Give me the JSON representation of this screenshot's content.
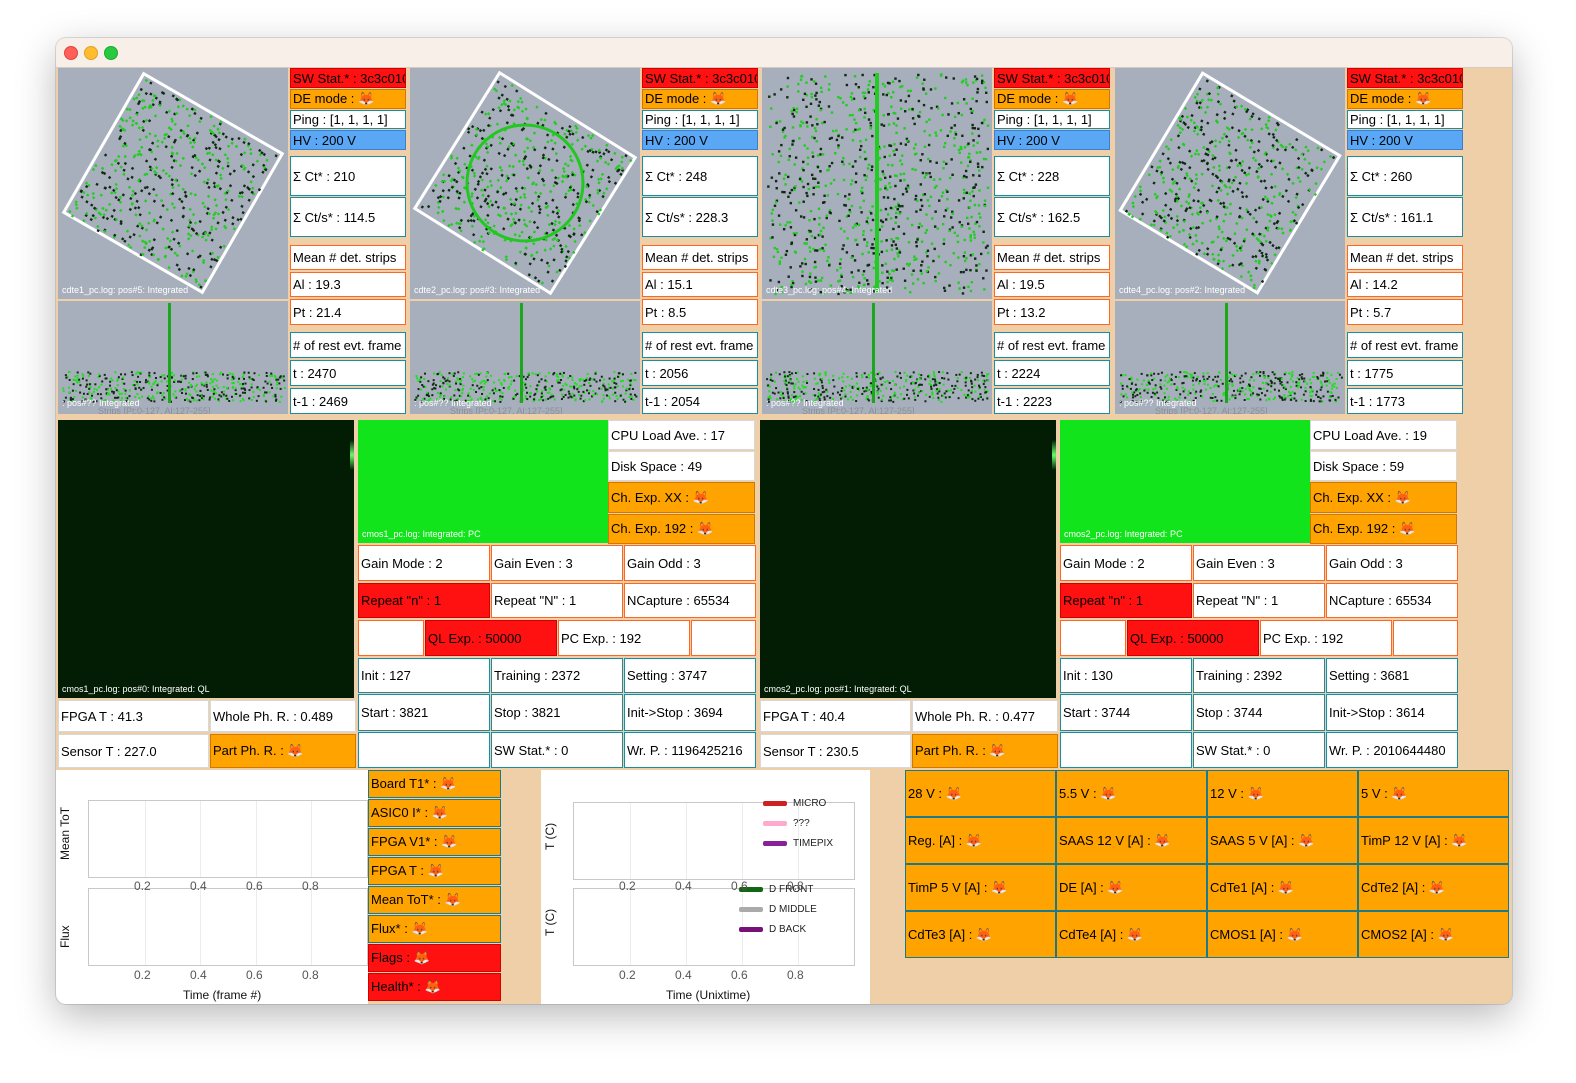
{
  "icons": {
    "status_icon": "fox-emoji"
  },
  "colors": {
    "red": "#ff1111",
    "orange": "#ffa300",
    "blue": "#5aa8f5",
    "green": "#11e41b"
  },
  "cdte": [
    {
      "sw_stat": "SW Stat.* : 3c3c010",
      "de_mode": "DE mode : 🦊",
      "ping": "Ping : [1, 1, 1, 1]",
      "hv": "HV : 200 V",
      "sum_ct": "Σ Ct* : 210",
      "sum_cts": "Σ Ct/s* : 114.5",
      "mean_label": "Mean # det. strips",
      "al": "Al : 19.3",
      "pt": "Pt : 21.4",
      "rest_label": "# of rest evt. frame",
      "t": "t : 2470",
      "t1": "t-1 : 2469",
      "img_label": "cdte1_pc.log: pos#5: Integrated",
      "strip_label": ": pos#?? Integrated",
      "strip_sub": "Strips [Pt:0-127, Al:127-255]"
    },
    {
      "sw_stat": "SW Stat.* : 3c3c010",
      "de_mode": "DE mode : 🦊",
      "ping": "Ping : [1, 1, 1, 1]",
      "hv": "HV : 200 V",
      "sum_ct": "Σ Ct* : 248",
      "sum_cts": "Σ Ct/s* : 228.3",
      "mean_label": "Mean # det. strips",
      "al": "Al : 15.1",
      "pt": "Pt : 8.5",
      "rest_label": "# of rest evt. frame",
      "t": "t : 2056",
      "t1": "t-1 : 2054",
      "img_label": "cdte2_pc.log: pos#3: Integrated",
      "strip_label": ": pos#?? Integrated",
      "strip_sub": "Strips [Pt:0-127, Al:127-255]"
    },
    {
      "sw_stat": "SW Stat.* : 3c3c010",
      "de_mode": "DE mode : 🦊",
      "ping": "Ping : [1, 1, 1, 1]",
      "hv": "HV : 200 V",
      "sum_ct": "Σ Ct* : 228",
      "sum_cts": "Σ Ct/s* : 162.5",
      "mean_label": "Mean # det. strips",
      "al": "Al : 19.5",
      "pt": "Pt : 13.2",
      "rest_label": "# of rest evt. frame",
      "t": "t : 2224",
      "t1": "t-1 : 2223",
      "img_label": "cdte3_pc.log: pos#4: Integrated",
      "strip_label": ": pos#?? Integrated",
      "strip_sub": "Strips [Pt:0-127, Al:127-255]"
    },
    {
      "sw_stat": "SW Stat.* : 3c3c010",
      "de_mode": "DE mode : 🦊",
      "ping": "Ping : [1, 1, 1, 1]",
      "hv": "HV : 200 V",
      "sum_ct": "Σ Ct* : 260",
      "sum_cts": "Σ Ct/s* : 161.1",
      "mean_label": "Mean # det. strips",
      "al": "Al : 14.2",
      "pt": "Pt : 5.7",
      "rest_label": "# of rest evt. frame",
      "t": "t : 1775",
      "t1": "t-1 : 1773",
      "img_label": "cdte4_pc.log: pos#2: Integrated",
      "strip_label": ": pos#?? Integrated",
      "strip_sub": "Strips [Pt:0-127, Al:127-255]"
    }
  ],
  "cmos": [
    {
      "ql_label": "cmos1_pc.log: pos#0: Integrated: QL",
      "pc_label": "cmos1_pc.log: Integrated: PC",
      "cpu": "CPU Load Ave. : 17",
      "disk": "Disk Space : 49",
      "ch_xx": "Ch. Exp. XX : 🦊",
      "ch_192": "Ch. Exp. 192 : 🦊",
      "gain_mode": "Gain Mode : 2",
      "gain_even": "Gain Even : 3",
      "gain_odd": "Gain Odd : 3",
      "repeat_n": "Repeat \"n\" : 1",
      "repeat_N": "Repeat \"N\" : 1",
      "ncapture": "NCapture : 65534",
      "ql_exp": "QL Exp. : 50000",
      "pc_exp": "PC Exp. : 192",
      "init": "Init : 127",
      "training": "Training : 2372",
      "setting": "Setting : 3747",
      "start": "Start : 3821",
      "stop": "Stop : 3821",
      "init_stop": "Init->Stop : 3694",
      "fpga_t": "FPGA T : 41.3",
      "whole_ph": "Whole Ph. R. : 0.489",
      "sensor_t": "Sensor T : 227.0",
      "part_ph": "Part Ph. R. : 🦊",
      "sw_stat": "SW Stat.* : 0",
      "wr_p": "Wr. P. : 1196425216"
    },
    {
      "ql_label": "cmos2_pc.log: pos#1: Integrated: QL",
      "pc_label": "cmos2_pc.log: Integrated: PC",
      "cpu": "CPU Load Ave. : 19",
      "disk": "Disk Space : 59",
      "ch_xx": "Ch. Exp. XX : 🦊",
      "ch_192": "Ch. Exp. 192 : 🦊",
      "gain_mode": "Gain Mode : 2",
      "gain_even": "Gain Even : 3",
      "gain_odd": "Gain Odd : 3",
      "repeat_n": "Repeat \"n\" : 1",
      "repeat_N": "Repeat \"N\" : 1",
      "ncapture": "NCapture : 65534",
      "ql_exp": "QL Exp. : 50000",
      "pc_exp": "PC Exp. : 192",
      "init": "Init : 130",
      "training": "Training : 2392",
      "setting": "Setting : 3681",
      "start": "Start : 3744",
      "stop": "Stop : 3744",
      "init_stop": "Init->Stop : 3614",
      "fpga_t": "FPGA T : 40.4",
      "whole_ph": "Whole Ph. R. : 0.477",
      "sensor_t": "Sensor T : 230.5",
      "part_ph": "Part Ph. R. : 🦊",
      "sw_stat": "SW Stat.* : 0",
      "wr_p": "Wr. P. : 2010644480"
    }
  ],
  "timepix": {
    "mean_tot_ylabel": "Mean ToT",
    "flux_ylabel": "Flux",
    "xlabel": "Time (frame #)",
    "ticks": [
      "0.2",
      "0.4",
      "0.6",
      "0.8"
    ],
    "status": [
      {
        "label": "Board T1* : 🦊",
        "state": "orange"
      },
      {
        "label": "ASIC0 I* : 🦊",
        "state": "orange"
      },
      {
        "label": "FPGA V1* : 🦊",
        "state": "orange"
      },
      {
        "label": "FPGA T : 🦊",
        "state": "orange"
      },
      {
        "label": "Mean ToT* : 🦊",
        "state": "orange"
      },
      {
        "label": "Flux* : 🦊",
        "state": "orange"
      },
      {
        "label": "Flags : 🦊",
        "state": "red"
      },
      {
        "label": "Health* : 🦊",
        "state": "red"
      }
    ]
  },
  "temps": {
    "ylabel": "T (C)",
    "xlabel": "Time (Unixtime)",
    "ticks": [
      "0.2",
      "0.4",
      "0.6",
      "0.8"
    ],
    "legend_top": [
      {
        "name": "MICRO",
        "color": "#cc2222"
      },
      {
        "name": "???",
        "color": "#ffaacc"
      },
      {
        "name": "TIMEPIX",
        "color": "#882299"
      }
    ],
    "legend_bottom": [
      {
        "name": "D FRONT",
        "color": "#116611"
      },
      {
        "name": "D MIDDLE",
        "color": "#aaaaaa"
      },
      {
        "name": "D BACK",
        "color": "#771177"
      }
    ]
  },
  "power": [
    [
      "28 V : 🦊",
      "5.5 V : 🦊",
      "12 V : 🦊",
      "5 V : 🦊"
    ],
    [
      "Reg. [A] : 🦊",
      "SAAS 12 V [A] : 🦊",
      "SAAS 5 V [A] : 🦊",
      "TimP 12 V [A] : 🦊"
    ],
    [
      "TimP 5 V [A] : 🦊",
      "DE [A] : 🦊",
      "CdTe1 [A] : 🦊",
      "CdTe2 [A] : 🦊"
    ],
    [
      "CdTe3 [A] : 🦊",
      "CdTe4 [A] : 🦊",
      "CMOS1 [A] : 🦊",
      "CMOS2 [A] : 🦊"
    ]
  ]
}
